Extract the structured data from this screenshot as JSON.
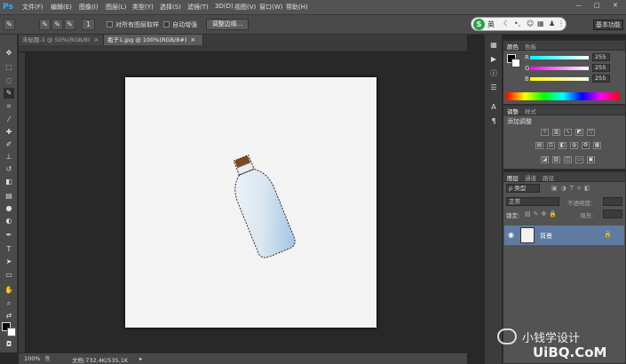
{
  "menubar": {
    "logo": "Ps",
    "items": [
      "文件(F)",
      "编辑(E)",
      "图像(I)",
      "图层(L)",
      "类型(Y)",
      "选择(S)",
      "滤镜(T)",
      "3D(D)",
      "视图(V)",
      "窗口(W)",
      "帮助(H)"
    ],
    "window_controls": [
      "—",
      "□",
      "✕"
    ]
  },
  "options": {
    "size_value": "1",
    "sample_all_layers": "对所有图层取样",
    "auto_enhance": "自动增强",
    "refine_edge": "调整边缘...",
    "ime_lang": "英",
    "workspace": "基本功能"
  },
  "doc_tabs": [
    {
      "label": "未标题-1 @ 50%(RGB/8)",
      "active": false
    },
    {
      "label": "瓶子1.jpg @ 100%(RGB/8#)",
      "active": true
    }
  ],
  "status": {
    "zoom": "100%",
    "doc_size": "文档:732.4K/535.1K"
  },
  "color_panel": {
    "tabs": [
      "颜色",
      "色板"
    ],
    "channels": [
      {
        "label": "R",
        "value": "255"
      },
      {
        "label": "G",
        "value": "255"
      },
      {
        "label": "B",
        "value": "255"
      }
    ]
  },
  "adjust_panel": {
    "tabs": [
      "调整",
      "样式"
    ],
    "title": "添加调整"
  },
  "layers_panel": {
    "tabs": [
      "图层",
      "通道",
      "路径"
    ],
    "filter_label": "ρ 类型",
    "blend_mode": "正常",
    "opacity_label": "不透明度:",
    "lock_label": "锁定:",
    "fill_label": "填充:",
    "layer_name": "背景"
  },
  "watermark": {
    "brand": "小钱学设计",
    "site": "UiBQ.CoM"
  },
  "colors": {
    "selection": "#2a2a2a",
    "layer_highlight": "#5f7ba1"
  }
}
